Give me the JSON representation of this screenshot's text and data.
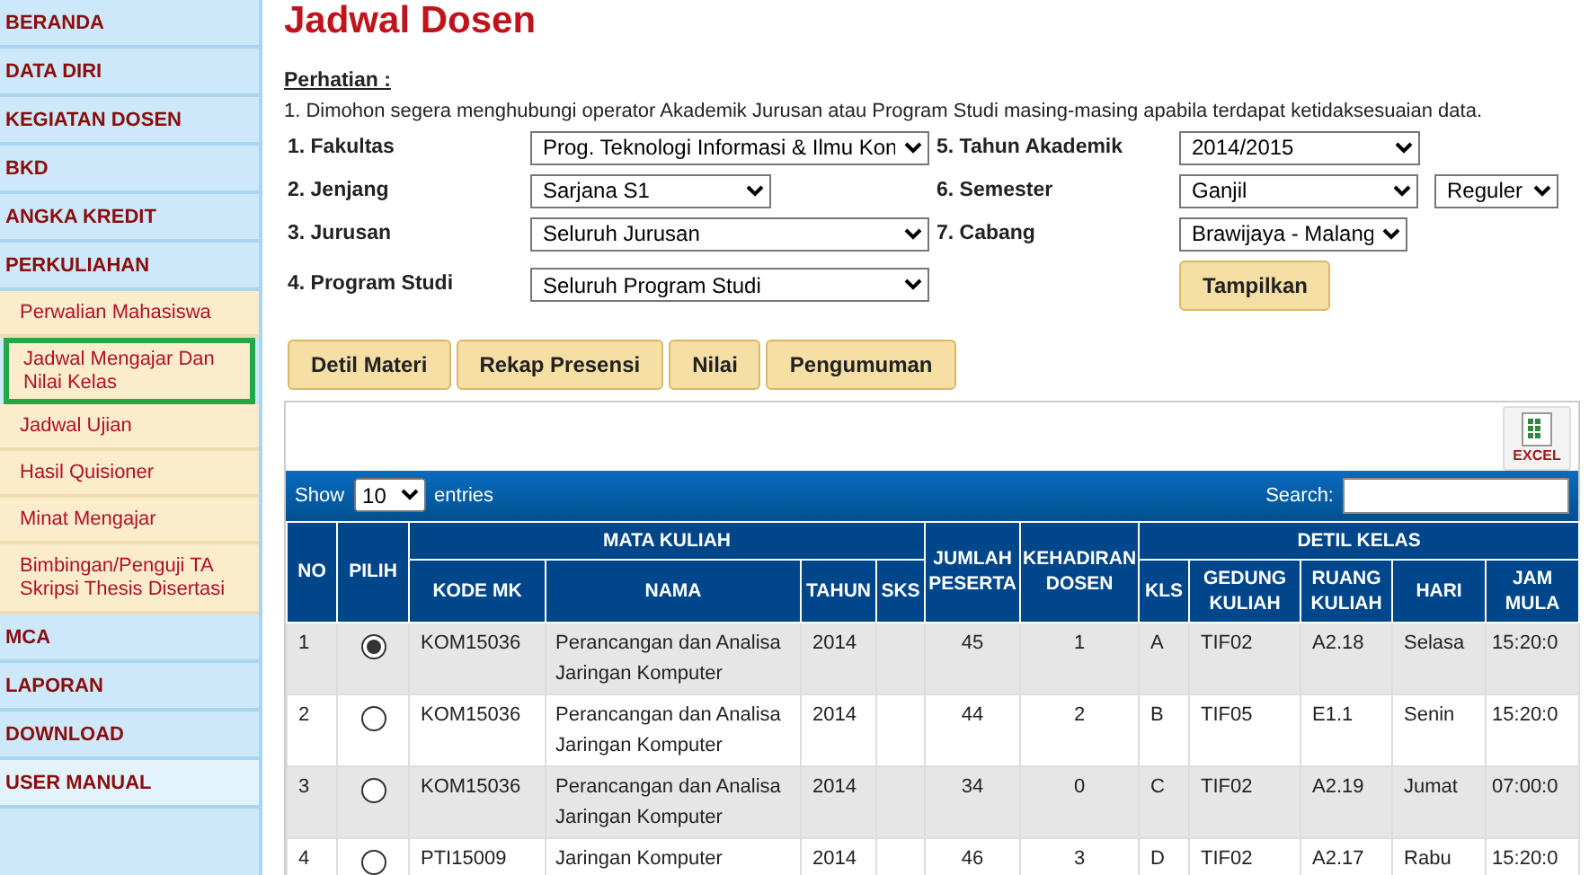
{
  "sidebar": {
    "items": [
      {
        "label": "BERANDA",
        "kind": "section",
        "selected": false,
        "hovered": false
      },
      {
        "label": "DATA DIRI",
        "kind": "section",
        "selected": false,
        "hovered": false
      },
      {
        "label": "KEGIATAN DOSEN",
        "kind": "section",
        "selected": false,
        "hovered": false
      },
      {
        "label": "BKD",
        "kind": "section",
        "selected": false,
        "hovered": false
      },
      {
        "label": "ANGKA KREDIT",
        "kind": "section",
        "selected": false,
        "hovered": false
      },
      {
        "label": "PERKULIAHAN",
        "kind": "section",
        "selected": false,
        "hovered": false
      },
      {
        "label": "Perwalian Mahasiswa",
        "kind": "subitem",
        "selected": false,
        "hovered": false
      },
      {
        "label": "Jadwal Mengajar Dan Nilai Kelas",
        "kind": "subitem",
        "selected": true,
        "hovered": false
      },
      {
        "label": "Jadwal Ujian",
        "kind": "subitem",
        "selected": false,
        "hovered": false
      },
      {
        "label": "Hasil Quisioner",
        "kind": "subitem",
        "selected": false,
        "hovered": false
      },
      {
        "label": "Minat Mengajar",
        "kind": "subitem",
        "selected": false,
        "hovered": false
      },
      {
        "label": "Bimbingan/Penguji TA Skripsi Thesis Disertasi",
        "kind": "subitem",
        "selected": false,
        "hovered": false
      },
      {
        "label": "MCA",
        "kind": "section",
        "selected": false,
        "hovered": false
      },
      {
        "label": "LAPORAN",
        "kind": "section",
        "selected": false,
        "hovered": false
      },
      {
        "label": "DOWNLOAD",
        "kind": "section",
        "selected": false,
        "hovered": false
      },
      {
        "label": "USER MANUAL",
        "kind": "section",
        "selected": false,
        "hovered": true
      }
    ]
  },
  "page_title": "Jadwal Dosen",
  "notice": {
    "heading": "Perhatian :",
    "text": "1. Dimohon segera menghubungi operator Akademik Jurusan atau Program Studi masing-masing apabila terdapat ketidaksesuaian data."
  },
  "filters": {
    "left": [
      {
        "label": "1. Fakultas",
        "value": "Prog. Teknologi Informasi & Ilmu Kon"
      },
      {
        "label": "2. Jenjang",
        "value": "Sarjana S1"
      },
      {
        "label": "3. Jurusan",
        "value": "Seluruh Jurusan"
      },
      {
        "label": "4. Program Studi",
        "value": "Seluruh Program Studi"
      }
    ],
    "right": [
      {
        "label": "5. Tahun Akademik",
        "value": "2014/2015"
      },
      {
        "label": "6. Semester",
        "value": "Ganjil",
        "extra_value": "Reguler"
      },
      {
        "label": "7. Cabang",
        "value": "Brawijaya - Malang"
      }
    ],
    "submit": "Tampilkan"
  },
  "action_buttons": [
    "Detil Materi",
    "Rekap Presensi",
    "Nilai",
    "Pengumuman"
  ],
  "export_button": {
    "label": "EXCEL"
  },
  "table_controls": {
    "show_label": "Show",
    "page_size": "10",
    "entries_label": "entries",
    "search_label": "Search:"
  },
  "table": {
    "columns": [
      {
        "label": "NO"
      },
      {
        "label": "PILIH"
      },
      {
        "label": "MATA KULIAH",
        "children": [
          {
            "label": "KODE MK"
          },
          {
            "label": "NAMA"
          },
          {
            "label": "TAHUN"
          },
          {
            "label": "SKS"
          }
        ]
      },
      {
        "label": "JUMLAH PESERTA"
      },
      {
        "label": "KEHADIRAN DOSEN"
      },
      {
        "label": "DETIL KELAS",
        "children": [
          {
            "label": "KLS"
          },
          {
            "label": "GEDUNG KULIAH"
          },
          {
            "label": "RUANG KULIAH"
          },
          {
            "label": "HARI"
          },
          {
            "label": "JAM MULA"
          }
        ]
      }
    ],
    "rows": [
      {
        "no": "1",
        "selected": true,
        "kode_mk": "KOM15036",
        "nama": "Perancangan dan Analisa Jaringan Komputer",
        "tahun": "2014",
        "jumlah_peserta": "45",
        "kehadiran_dosen": "1",
        "kls": "A",
        "gedung_kuliah": "TIF02",
        "ruang_kuliah": "A2.18",
        "hari": "Selasa",
        "jam_mulai": "15:20:0"
      },
      {
        "no": "2",
        "selected": false,
        "kode_mk": "KOM15036",
        "nama": "Perancangan dan Analisa Jaringan Komputer",
        "tahun": "2014",
        "jumlah_peserta": "44",
        "kehadiran_dosen": "2",
        "kls": "B",
        "gedung_kuliah": "TIF05",
        "ruang_kuliah": "E1.1",
        "hari": "Senin",
        "jam_mulai": "15:20:0"
      },
      {
        "no": "3",
        "selected": false,
        "kode_mk": "KOM15036",
        "nama": "Perancangan dan Analisa Jaringan Komputer",
        "tahun": "2014",
        "jumlah_peserta": "34",
        "kehadiran_dosen": "0",
        "kls": "C",
        "gedung_kuliah": "TIF02",
        "ruang_kuliah": "A2.19",
        "hari": "Jumat",
        "jam_mulai": "07:00:0"
      },
      {
        "no": "4",
        "selected": false,
        "kode_mk": "PTI15009",
        "nama": "Jaringan Komputer",
        "tahun": "2014",
        "jumlah_peserta": "46",
        "kehadiran_dosen": "3",
        "kls": "D",
        "gedung_kuliah": "TIF02",
        "ruang_kuliah": "A2.17",
        "hari": "Rabu",
        "jam_mulai": "15:20:0"
      }
    ]
  }
}
